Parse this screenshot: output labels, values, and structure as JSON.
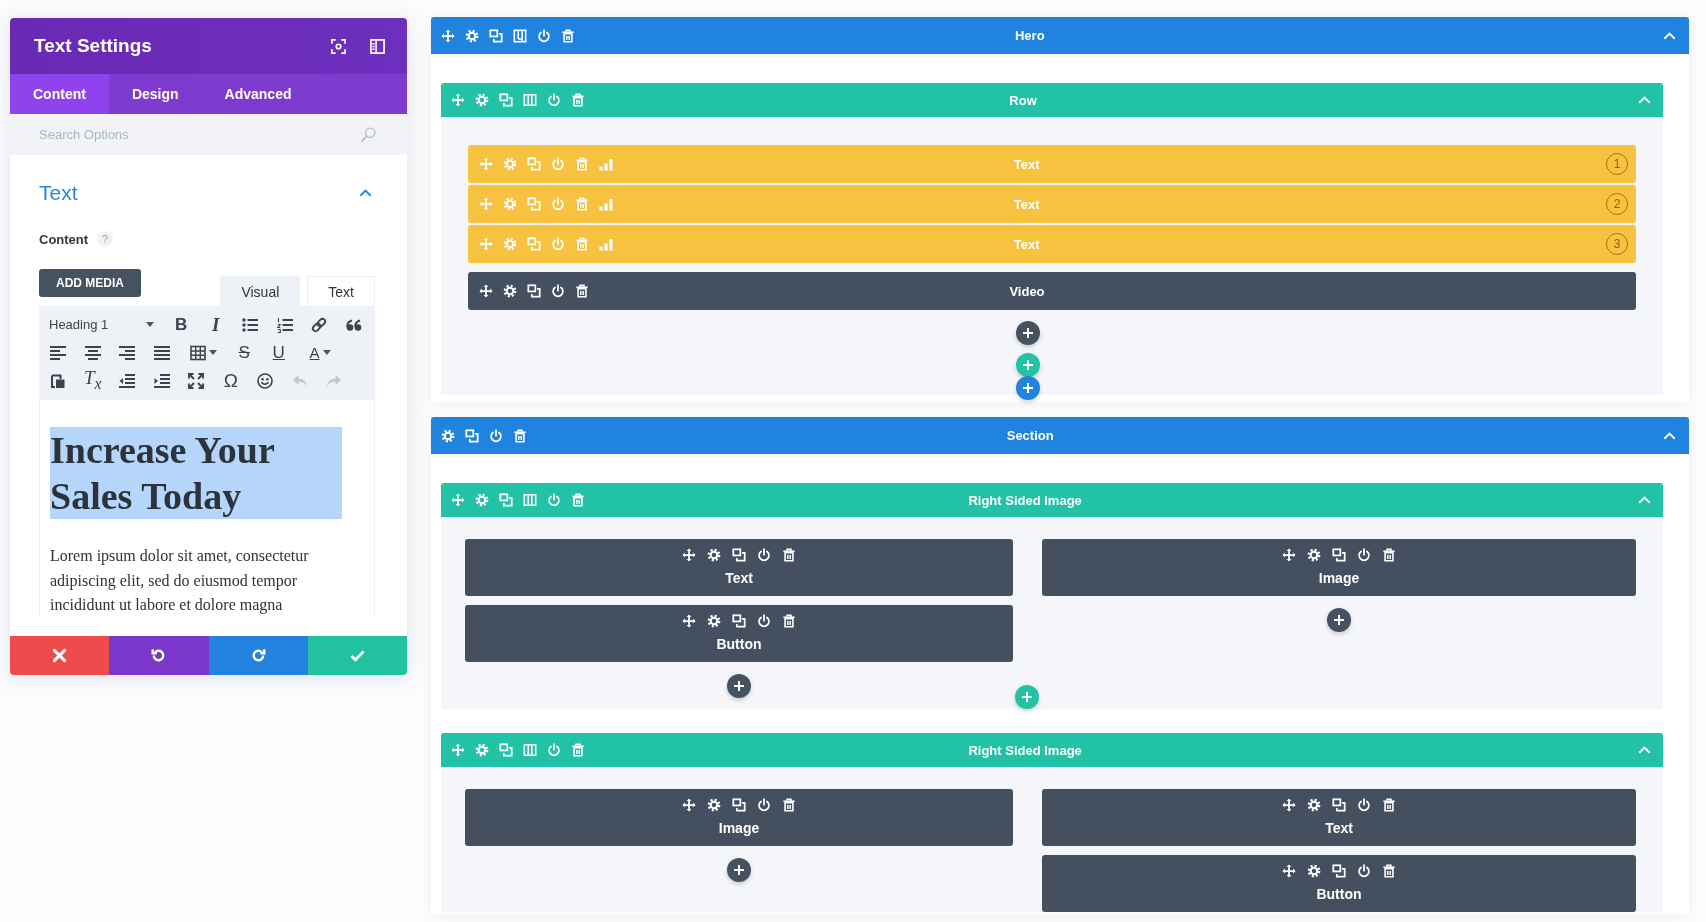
{
  "settings_panel": {
    "title": "Text Settings",
    "tabs": [
      {
        "label": "Content",
        "selected": true
      },
      {
        "label": "Design",
        "selected": false
      },
      {
        "label": "Advanced",
        "selected": false
      }
    ],
    "search": {
      "placeholder": "Search Options"
    },
    "group": {
      "title": "Text",
      "expanded": true
    },
    "field": {
      "label": "Content",
      "help": "?"
    },
    "add_media": "ADD MEDIA",
    "editor_tabs": [
      {
        "label": "Visual",
        "selected": true
      },
      {
        "label": "Text",
        "selected": false
      }
    ],
    "toolbar_rows": [
      [
        {
          "kind": "format-select",
          "value": "Heading 1",
          "disabled": false
        },
        {
          "kind": "bold",
          "label": "B",
          "disabled": false
        },
        {
          "kind": "italic",
          "label": "I",
          "disabled": false
        },
        {
          "kind": "bullet-list",
          "disabled": false
        },
        {
          "kind": "numbered-list",
          "disabled": false
        },
        {
          "kind": "link",
          "disabled": false
        },
        {
          "kind": "blockquote",
          "disabled": false
        }
      ],
      [
        {
          "kind": "align-left",
          "disabled": false
        },
        {
          "kind": "align-center",
          "disabled": false
        },
        {
          "kind": "align-right",
          "disabled": false
        },
        {
          "kind": "justify",
          "disabled": false
        },
        {
          "kind": "table",
          "disabled": false
        },
        {
          "kind": "strikethrough",
          "label": "S",
          "disabled": false
        },
        {
          "kind": "underline",
          "label": "U",
          "disabled": false
        },
        {
          "kind": "text-color",
          "label": "A",
          "disabled": false
        }
      ],
      [
        {
          "kind": "paste-text",
          "disabled": false
        },
        {
          "kind": "clear-formatting",
          "label": "T$_{x}$",
          "disabled": false
        },
        {
          "kind": "outdent",
          "disabled": false
        },
        {
          "kind": "indent",
          "disabled": false
        },
        {
          "kind": "fullscreen",
          "disabled": false
        },
        {
          "kind": "special-character",
          "label": "Ω",
          "disabled": false
        },
        {
          "kind": "emoji",
          "disabled": false
        },
        {
          "kind": "undo",
          "disabled": true
        },
        {
          "kind": "redo",
          "disabled": true
        }
      ]
    ],
    "heading": {
      "text": "Increase Your Sales Today",
      "highlighted": true
    },
    "paragraph": "Lorem ipsum dolor sit amet, consectetur adipiscing elit, sed do eiusmod tempor incididunt ut labore et dolore magna",
    "actions": [
      {
        "kind": "cancel"
      },
      {
        "kind": "undo"
      },
      {
        "kind": "redo"
      },
      {
        "kind": "save"
      }
    ]
  },
  "builder": {
    "sections": [
      {
        "label": "Hero",
        "kind": "fullwidth",
        "expanded": true,
        "add_section": true,
        "rows": [
          {
            "label": "Row",
            "expanded": true,
            "add_row": true,
            "columns": [
              {
                "add_module": true,
                "modules": [
                  {
                    "label": "Text",
                    "kind": "subject",
                    "badge": "1"
                  },
                  {
                    "label": "Text",
                    "kind": "subject",
                    "badge": "2"
                  },
                  {
                    "label": "Text",
                    "kind": "subject",
                    "badge": "3"
                  },
                  {
                    "label": "Video",
                    "kind": "plain"
                  }
                ]
              }
            ]
          }
        ]
      },
      {
        "label": "Section",
        "kind": "regular",
        "expanded": true,
        "rows": [
          {
            "label": "Right Sided Image",
            "expanded": true,
            "add_row": true,
            "columns": [
              {
                "add_module": true,
                "modules": [
                  {
                    "label": "Text",
                    "kind": "plain"
                  },
                  {
                    "label": "Button",
                    "kind": "plain"
                  }
                ]
              },
              {
                "add_module": true,
                "modules": [
                  {
                    "label": "Image",
                    "kind": "plain"
                  }
                ]
              }
            ]
          },
          {
            "label": "Right Sided Image",
            "expanded": true,
            "columns": [
              {
                "add_module": true,
                "modules": [
                  {
                    "label": "Image",
                    "kind": "plain"
                  }
                ]
              },
              {
                "modules": [
                  {
                    "label": "Text",
                    "kind": "plain"
                  },
                  {
                    "label": "Button",
                    "kind": "plain"
                  }
                ]
              }
            ]
          }
        ]
      }
    ]
  }
}
